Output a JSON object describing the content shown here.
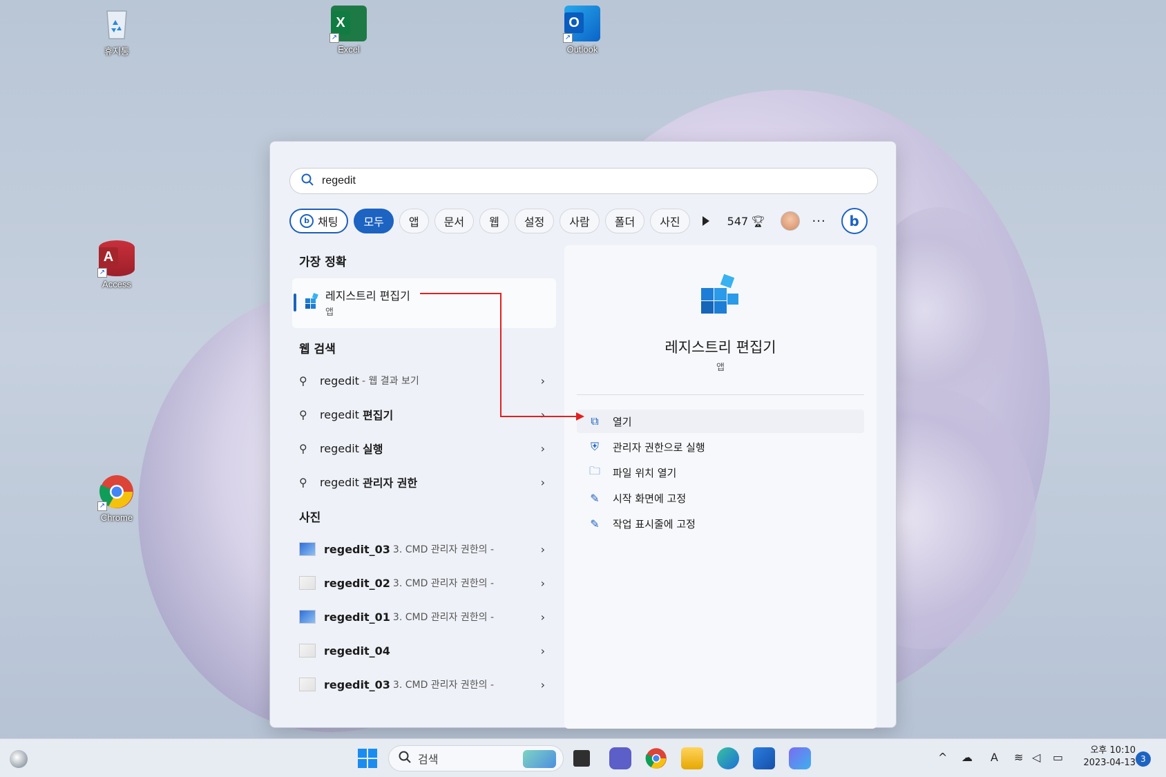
{
  "desktop": {
    "icons": [
      {
        "label": "휴지통",
        "icon": "recycle-bin-icon"
      },
      {
        "label": "Excel",
        "icon": "excel-icon"
      },
      {
        "label": "Outlook",
        "icon": "outlook-icon"
      },
      {
        "label": "Access",
        "icon": "access-icon"
      },
      {
        "label": "Chrome",
        "icon": "chrome-icon"
      }
    ]
  },
  "search": {
    "query": "regedit",
    "filters": [
      "채팅",
      "모두",
      "앱",
      "문서",
      "웹",
      "설정",
      "사람",
      "폴더",
      "사진"
    ],
    "active_filter": "모두",
    "points": "547",
    "more": "···"
  },
  "results": {
    "best_match_title": "가장 정확",
    "best_match": {
      "name": "레지스트리 편집기",
      "type": "앱"
    },
    "web_title": "웹 검색",
    "web": [
      {
        "query": "regedit",
        "suffix": "",
        "muted": "- 웹 결과 보기"
      },
      {
        "query": "regedit",
        "suffix": "편집기",
        "muted": ""
      },
      {
        "query": "regedit",
        "suffix": "실행",
        "muted": ""
      },
      {
        "query": "regedit",
        "suffix": "관리자 권한",
        "muted": ""
      }
    ],
    "photos_title": "사진",
    "photos": [
      {
        "name": "regedit_03",
        "muted": "3. CMD 관리자 권한의 -"
      },
      {
        "name": "regedit_02",
        "muted": "3. CMD 관리자 권한의 -"
      },
      {
        "name": "regedit_01",
        "muted": "3. CMD 관리자 권한의 -"
      },
      {
        "name": "regedit_04",
        "muted": ""
      },
      {
        "name": "regedit_03",
        "muted": "3. CMD 관리자 권한의 -"
      }
    ]
  },
  "preview": {
    "title": "레지스트리 편집기",
    "type": "앱",
    "actions": [
      {
        "label": "열기",
        "icon": "open-external-icon"
      },
      {
        "label": "관리자 권한으로 실행",
        "icon": "shield-icon"
      },
      {
        "label": "파일 위치 열기",
        "icon": "folder-icon"
      },
      {
        "label": "시작 화면에 고정",
        "icon": "pin-icon"
      },
      {
        "label": "작업 표시줄에 고정",
        "icon": "pin-icon"
      }
    ]
  },
  "taskbar": {
    "search_placeholder": "검색",
    "clock_period": "오후 10:10",
    "clock_date": "2023-04-13",
    "notification_count": "3",
    "ime": "A"
  },
  "colors": {
    "accent": "#1c63c2",
    "annotation": "#e21f1f"
  }
}
